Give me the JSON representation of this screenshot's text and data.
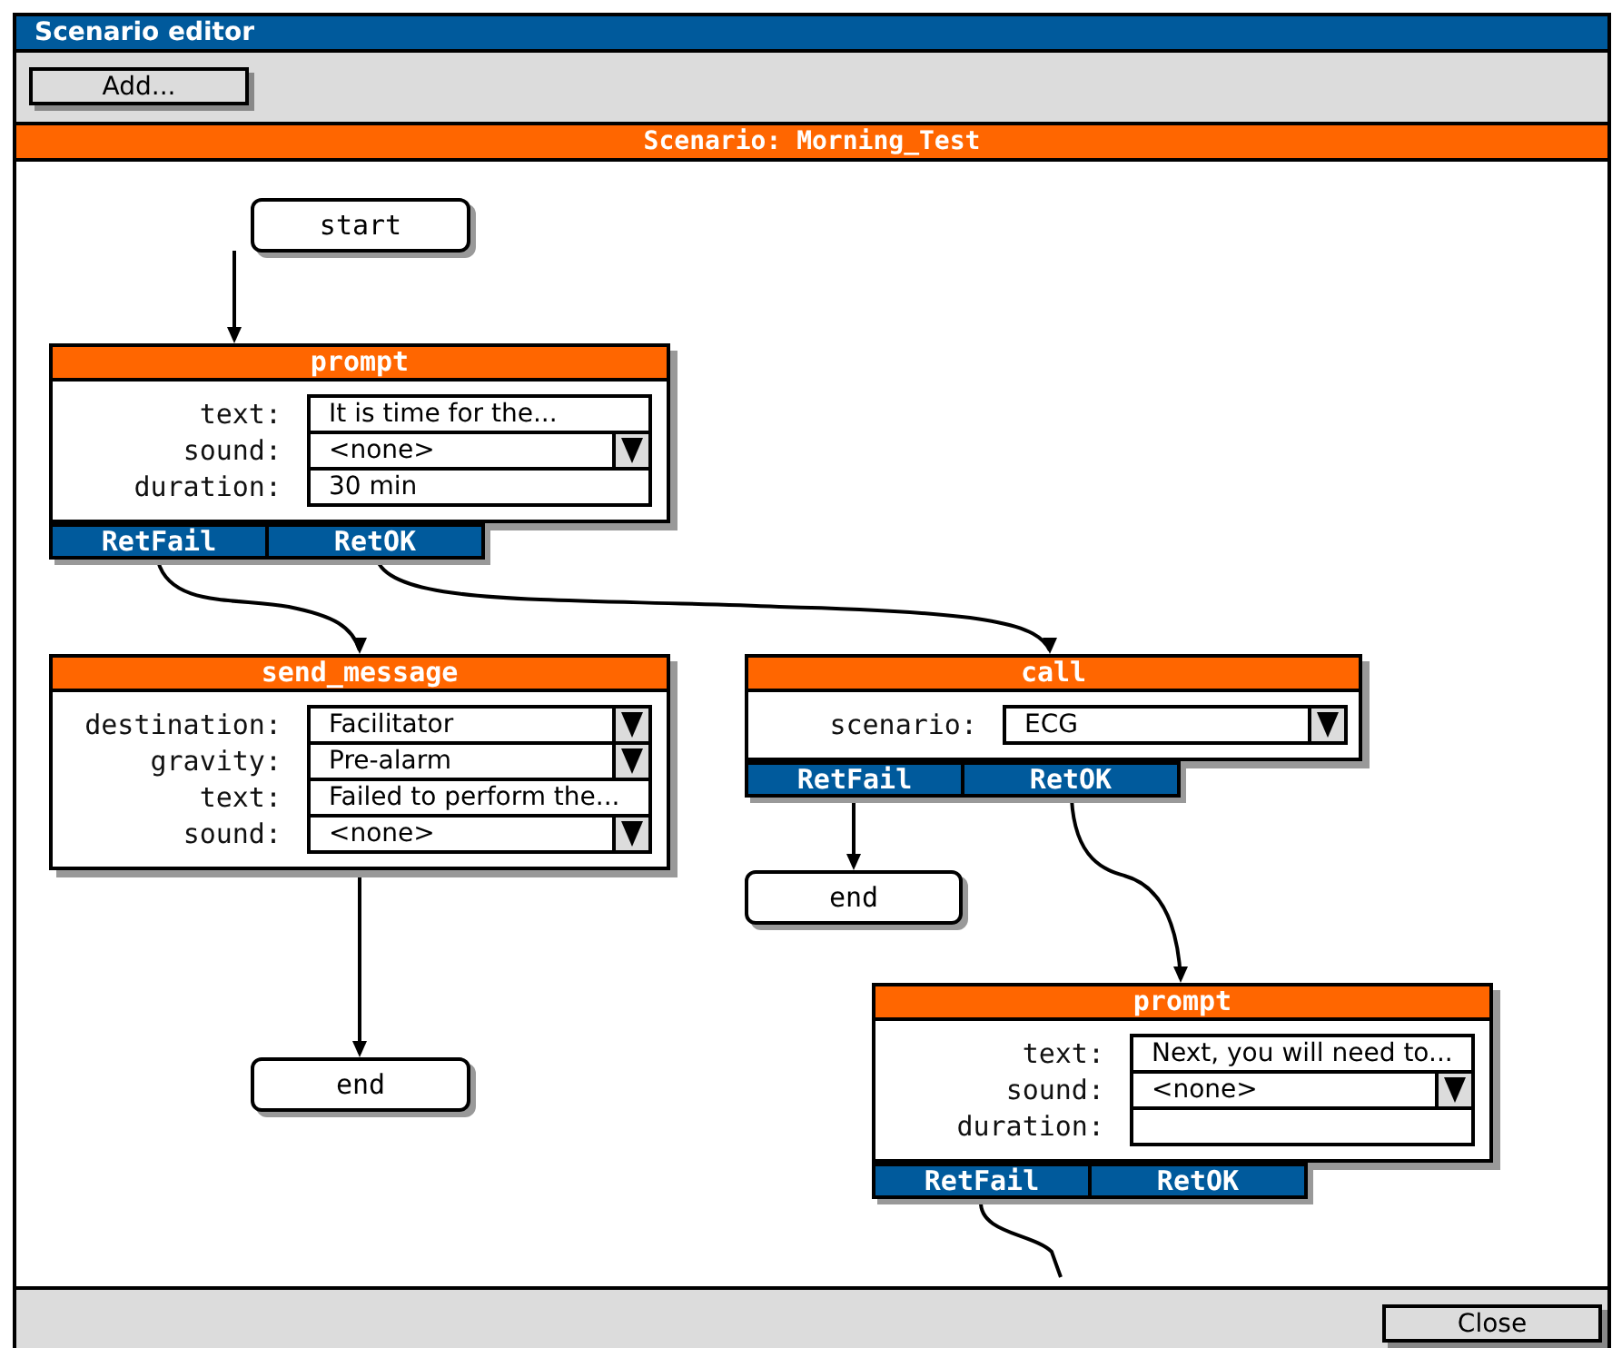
{
  "window": {
    "title": "Scenario editor"
  },
  "toolbar": {
    "add_button": "Add..."
  },
  "scenario": {
    "title": "Scenario: Morning_Test"
  },
  "nodes": [
    {
      "kind": "terminal",
      "label": "start"
    },
    {
      "kind": "block",
      "title": "prompt",
      "fields": [
        {
          "label": "text:",
          "kind": "text",
          "value": "It is time for the..."
        },
        {
          "label": "sound:",
          "kind": "dropdown",
          "value": "<none>"
        },
        {
          "label": "duration:",
          "kind": "text",
          "value": "30 min"
        }
      ],
      "ports": [
        "RetFail",
        "RetOK"
      ]
    },
    {
      "kind": "block",
      "title": "send_message",
      "fields": [
        {
          "label": "destination:",
          "kind": "dropdown",
          "value": "Facilitator"
        },
        {
          "label": "gravity:",
          "kind": "dropdown",
          "value": "Pre-alarm"
        },
        {
          "label": "text:",
          "kind": "text",
          "value": "Failed to perform the..."
        },
        {
          "label": "sound:",
          "kind": "dropdown",
          "value": "<none>"
        }
      ]
    },
    {
      "kind": "terminal",
      "label": "end"
    },
    {
      "kind": "block",
      "title": "call",
      "fields": [
        {
          "label": "scenario:",
          "kind": "dropdown",
          "value": "ECG"
        }
      ],
      "ports": [
        "RetFail",
        "RetOK"
      ]
    },
    {
      "kind": "terminal",
      "label": "end"
    },
    {
      "kind": "block",
      "title": "prompt",
      "fields": [
        {
          "label": "text:",
          "kind": "text",
          "value": "Next, you will need to..."
        },
        {
          "label": "sound:",
          "kind": "dropdown",
          "value": "<none>"
        },
        {
          "label": "duration:",
          "kind": "text"
        }
      ],
      "ports": [
        "RetFail",
        "RetOK"
      ]
    }
  ],
  "footer": {
    "close_button": "Close"
  }
}
